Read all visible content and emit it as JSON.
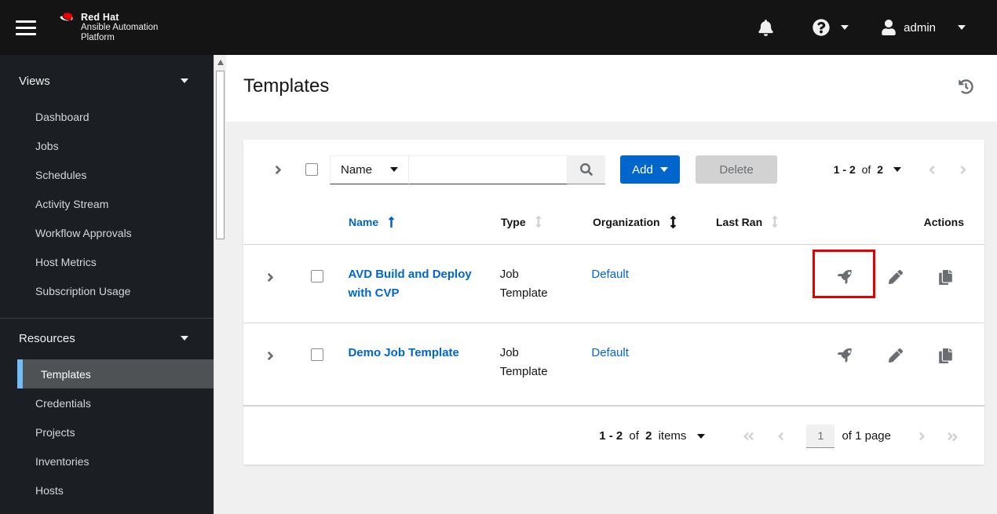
{
  "colors": {
    "accent_blue": "#0066cc",
    "nav_selected_border": "#73bcf7",
    "masthead_bg": "#141414",
    "sidebar_bg": "#1b1e23",
    "annotation_red": "#e60000",
    "disabled_gray": "#d2d2d2",
    "icon_gray": "#6a6e73"
  },
  "masthead": {
    "brand_line1": "Red Hat",
    "brand_line2": "Ansible Automation",
    "brand_line3": "Platform",
    "user_name": "admin"
  },
  "sidebar": {
    "sections": [
      {
        "label": "Views",
        "items": [
          {
            "label": "Dashboard"
          },
          {
            "label": "Jobs"
          },
          {
            "label": "Schedules"
          },
          {
            "label": "Activity Stream"
          },
          {
            "label": "Workflow Approvals"
          },
          {
            "label": "Host Metrics"
          },
          {
            "label": "Subscription Usage"
          }
        ]
      },
      {
        "label": "Resources",
        "items": [
          {
            "label": "Templates",
            "selected": true
          },
          {
            "label": "Credentials"
          },
          {
            "label": "Projects"
          },
          {
            "label": "Inventories"
          },
          {
            "label": "Hosts"
          }
        ]
      }
    ]
  },
  "page": {
    "title": "Templates"
  },
  "toolbar": {
    "filter_selected": "Name",
    "search_value": "",
    "add_label": "Add",
    "delete_label": "Delete",
    "pagination": {
      "range": "1 - 2",
      "of_word": "of",
      "total": "2"
    }
  },
  "table": {
    "headers": {
      "name": "Name",
      "type": "Type",
      "organization": "Organization",
      "last_ran": "Last Ran",
      "actions": "Actions"
    },
    "rows": [
      {
        "name": "AVD Build and Deploy with CVP",
        "type": "Job Template",
        "organization": "Default",
        "last_ran": ""
      },
      {
        "name": "Demo Job Template",
        "type": "Job Template",
        "organization": "Default",
        "last_ran": ""
      }
    ]
  },
  "footer_pagination": {
    "range": "1 - 2",
    "of_word": "of",
    "total": "2",
    "items_word": "items",
    "page_value": "1",
    "page_of_label": "of 1 page"
  }
}
